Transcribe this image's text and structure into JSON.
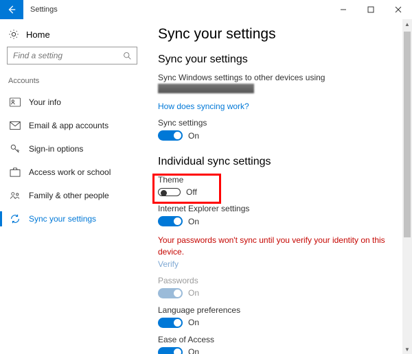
{
  "window": {
    "title": "Settings",
    "min": "—",
    "max": "▢",
    "close": "✕"
  },
  "home": {
    "label": "Home"
  },
  "search": {
    "placeholder": "Find a setting",
    "value": ""
  },
  "sidebar": {
    "section": "Accounts",
    "items": [
      {
        "label": "Your info"
      },
      {
        "label": "Email & app accounts"
      },
      {
        "label": "Sign-in options"
      },
      {
        "label": "Access work or school"
      },
      {
        "label": "Family & other people"
      },
      {
        "label": "Sync your settings"
      }
    ]
  },
  "main": {
    "page_title": "Sync your settings",
    "section1_title": "Sync your settings",
    "desc": "Sync Windows settings to other devices using",
    "help_link": "How does syncing work?",
    "sync_settings": {
      "label": "Sync settings",
      "status": "On"
    },
    "section2_title": "Individual sync settings",
    "theme": {
      "label": "Theme",
      "status": "Off"
    },
    "ie": {
      "label": "Internet Explorer settings",
      "status": "On"
    },
    "error": "Your passwords won't sync until you verify your identity on this device.",
    "verify": "Verify",
    "passwords": {
      "label": "Passwords",
      "status": "On"
    },
    "language": {
      "label": "Language preferences",
      "status": "On"
    },
    "ease": {
      "label": "Ease of Access",
      "status": "On"
    }
  }
}
